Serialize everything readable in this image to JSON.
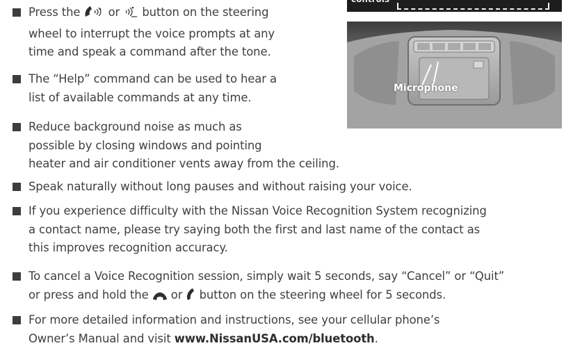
{
  "figure_top": {
    "caption": "controls"
  },
  "figure": {
    "microphone_label": "Microphone"
  },
  "items": [
    {
      "l1_a": "Press the ",
      "l1_b": " or ",
      "l1_c": " button on the steering",
      "l2": "wheel to interrupt the voice prompts at any",
      "l3": "time and speak a command after the tone.",
      "icons": [
        "phone-voice-icon",
        "voice-icon"
      ]
    },
    {
      "l1": "The “Help” command can be used to hear a",
      "l2": "list of available commands at any time."
    },
    {
      "l1": "Reduce background noise as much as",
      "l2": "possible by closing windows and pointing",
      "l3": "heater and air conditioner vents away from the ceiling."
    },
    {
      "l1": "Speak naturally without long pauses and without raising your voice."
    },
    {
      "l1": "If you experience difficulty with the Nissan Voice Recognition System recognizing",
      "l2": "a contact name, please try saying both the first and last name of the contact as",
      "l3": "this improves recognition accuracy."
    },
    {
      "l1": "To cancel a Voice Recognition session, simply wait 5 seconds, say “Cancel” or “Quit”",
      "l2_a": "or press and hold the ",
      "l2_b": " or ",
      "l2_c": " button on the steering wheel for 5 seconds.",
      "icons": [
        "hang-up-icon",
        "phone-icon"
      ]
    },
    {
      "l1": "For more detailed information and instructions, see your cellular phone’s",
      "l2_a": "Owner’s Manual and visit ",
      "link": "www.NissanUSA.com/bluetooth",
      "l2_b": "."
    }
  ]
}
